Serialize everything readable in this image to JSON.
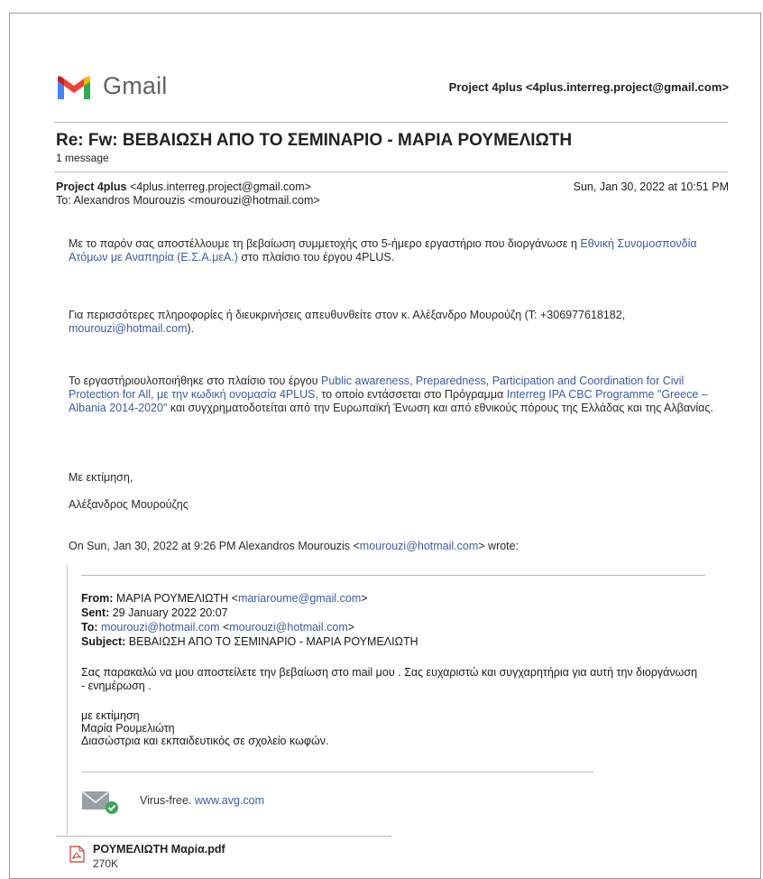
{
  "header": {
    "app_name": "Gmail",
    "account": "Project 4plus <4plus.interreg.project@gmail.com>"
  },
  "thread": {
    "subject": "Re: Fw: ΒΕΒΑΙΩΣΗ ΑΠΟ ΤΟ ΣΕΜΙΝΑΡΙΟ - ΜΑΡΙΑ ΡΟΥΜΕΛΙΩΤΗ",
    "count": "1 message"
  },
  "message": {
    "from_name": "Project 4plus",
    "from_email": "<4plus.interreg.project@gmail.com>",
    "date": "Sun, Jan 30, 2022 at 10:51 PM",
    "to": "To: Alexandros Mourouzis <mourouzi@hotmail.com>",
    "p1_a": "Με το παρόν σας αποστέλλουμε τη βεβαίωση συμμετοχής στο 5-ήμερο εργαστήριο που διοργάνωσε η ",
    "p1_link": "Εθνική Συνομοσπονδία Ατόμων με Αναπηρία (Ε.Σ.Α.μεΑ.)",
    "p1_b": " στο πλαίσιο του έργου 4PLUS.",
    "p2_a": "Για περισσότερες πληροφορίες ή διευκρινήσεις απευθυνθείτε στον κ. Αλέξανδρο Μουρούζη (Τ: +306977618182, ",
    "p2_link": "mourouzi@hotmail.com",
    "p2_b": ").",
    "p3_a": "Το εργαστήριουλοποιήθηκε στο πλαίσιο του έργου ",
    "p3_link1": "Public awareness, Preparedness, Participation and Coordination for Civil Protection for All, με την κωδική ονομασία 4PLUS,",
    "p3_b": " το οποίο εντάσσεται στο Πρόγραμμα ",
    "p3_link2": "Interreg IPA CBC Programme \"Greece – Albania 2014-2020\"",
    "p3_c": " και συγχρηματοδοτείται από την Ευρωπαϊκή Ένωση και από εθνικούς πόρους της Ελλάδας και της Αλβανίας.",
    "closing": "Με εκτίμηση,",
    "signature": "Αλέξανδρος Μουρούζης",
    "quote_intro_a": "On Sun, Jan 30, 2022 at 9:26 PM Alexandros Mourouzis <",
    "quote_intro_link": "mourouzi@hotmail.com",
    "quote_intro_b": "> wrote:"
  },
  "quoted": {
    "from_label": "From:",
    "from_name": " ΜΑΡΙΑ ΡΟΥΜΕΛΙΩΤΗ <",
    "from_link": "mariaroume@gmail.com",
    "from_end": ">",
    "sent_label": "Sent:",
    "sent_value": " 29 January 2022 20:07",
    "to_label": "To:",
    "to_link1": "mourouzi@hotmail.com",
    "to_mid": " <",
    "to_link2": "mourouzi@hotmail.com",
    "to_end": ">",
    "subject_label": "Subject:",
    "subject_value": " ΒΕΒΑΙΩΣΗ ΑΠΟ ΤΟ ΣΕΜΙΝΑΡΙΟ - ΜΑΡΙΑ ΡΟΥΜΕΛΙΩΤΗ",
    "body": "Σας παρακαλώ να μου αποστείλετε την βεβαίωση στο mail μου . Σας ευχαριστώ και συγχαρητήρια για αυτή την διοργάνωση - ενημέρωση .",
    "sig1": "με εκτίμηση",
    "sig2": "Μαρία Ρουμελιώτη",
    "sig3": "Διασώστρια και εκπαιδευτικός σε σχολείο κωφών.",
    "avg_text": "Virus-free. ",
    "avg_link": "www.avg.com"
  },
  "attachment": {
    "name": "ΡΟΥΜΕΛΙΩΤΗ Μαρία.pdf",
    "size": "270K"
  },
  "colors": {
    "link": "#3b5ba5",
    "gmail_red": "#ea4335",
    "gmail_blue": "#4285f4",
    "gmail_green": "#34a853",
    "gmail_yellow": "#fbbc04"
  }
}
